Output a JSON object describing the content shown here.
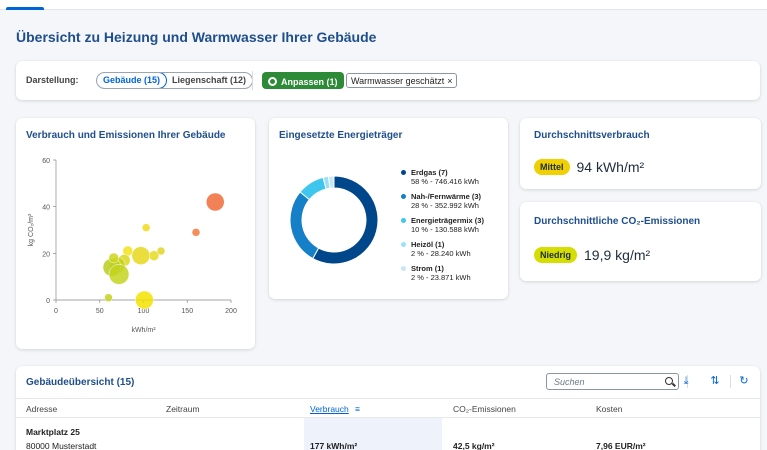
{
  "page": {
    "title": "Übersicht zu Heizung und Warmwasser Ihrer Gebäude"
  },
  "filter": {
    "label": "Darstellung:",
    "segments": [
      "Gebäude (15)",
      "Liegenschaft (12)"
    ],
    "adjust_button": "Anpassen (1)",
    "chip": "Warmwasser geschätzt"
  },
  "scatter": {
    "title": "Verbrauch und Emissionen Ihrer Gebäude",
    "chart_data": {
      "type": "scatter",
      "title": "Verbrauch und Emissionen Ihrer Gebäude",
      "xlabel": "kWh/m²",
      "ylabel": "kg CO₂/m²",
      "xlim": [
        0,
        200
      ],
      "ylim": [
        0,
        60
      ],
      "xticks": [
        0,
        50,
        100,
        150,
        200
      ],
      "yticks": [
        0,
        20,
        40,
        60
      ],
      "points": [
        {
          "x": 60,
          "y": 1,
          "r": 4,
          "color": "#c6d31f"
        },
        {
          "x": 101,
          "y": 0,
          "r": 9,
          "color": "#f3e200"
        },
        {
          "x": 103,
          "y": 31,
          "r": 4,
          "color": "#f0dc1a"
        },
        {
          "x": 160,
          "y": 29,
          "r": 4,
          "color": "#f47a3c"
        },
        {
          "x": 182,
          "y": 42,
          "r": 9,
          "color": "#f06b3a"
        },
        {
          "x": 120,
          "y": 21,
          "r": 4,
          "color": "#e4d52a"
        },
        {
          "x": 112,
          "y": 19,
          "r": 5,
          "color": "#e8da20"
        },
        {
          "x": 97,
          "y": 19,
          "r": 9,
          "color": "#e6d71c"
        },
        {
          "x": 82,
          "y": 21,
          "r": 5,
          "color": "#f2e21d"
        },
        {
          "x": 78,
          "y": 17,
          "r": 6,
          "color": "#d9d81a"
        },
        {
          "x": 70,
          "y": 15,
          "r": 8,
          "color": "#c8d21c"
        },
        {
          "x": 64,
          "y": 14,
          "r": 9,
          "color": "#b9cf20"
        },
        {
          "x": 72,
          "y": 11,
          "r": 10,
          "color": "#c4d31e"
        },
        {
          "x": 66,
          "y": 18,
          "r": 5,
          "color": "#cdd61e"
        }
      ]
    }
  },
  "energy": {
    "title": "Eingesetzte Energieträger",
    "chart_data": {
      "type": "pie",
      "donut": true,
      "slices": [
        {
          "label": "Erdgas (7)",
          "detail": "58 % - 746.416 kWh",
          "value": 58,
          "color": "#00468b"
        },
        {
          "label": "Nah-/Fernwärme (3)",
          "detail": "28 % - 352.992 kWh",
          "value": 28,
          "color": "#1580c8"
        },
        {
          "label": "Energieträgermix (3)",
          "detail": "10 % - 130.588 kWh",
          "value": 10,
          "color": "#3ec6ee"
        },
        {
          "label": "Heizöl (1)",
          "detail": "2 % - 28.240 kWh",
          "value": 2,
          "color": "#9be0f3"
        },
        {
          "label": "Strom (1)",
          "detail": "2 % - 23.871 kWh",
          "value": 2,
          "color": "#c9e6f3"
        }
      ]
    }
  },
  "kpi1": {
    "title": "Durchschnittsverbrauch",
    "badge": "Mittel",
    "badge_color": "#f0d000",
    "value": "94 kWh/m²"
  },
  "kpi2": {
    "title": "Durchschnittliche CO₂-Emissionen",
    "badge": "Niedrig",
    "badge_color": "#d6dd00",
    "value": "19,9 kg/m²"
  },
  "table": {
    "title": "Gebäudeübersicht (15)",
    "search_placeholder": "Suchen",
    "columns": [
      "Adresse",
      "Zeitraum",
      "Verbrauch",
      "CO₂-Emissionen",
      "Kosten"
    ],
    "rows": [
      {
        "street": "Marktplatz 25",
        "city": "80000 Musterstadt",
        "verbrauch": "177 kWh/m²",
        "co2": "42,5 kg/m²",
        "kosten": "7,96 EUR/m²"
      }
    ]
  }
}
